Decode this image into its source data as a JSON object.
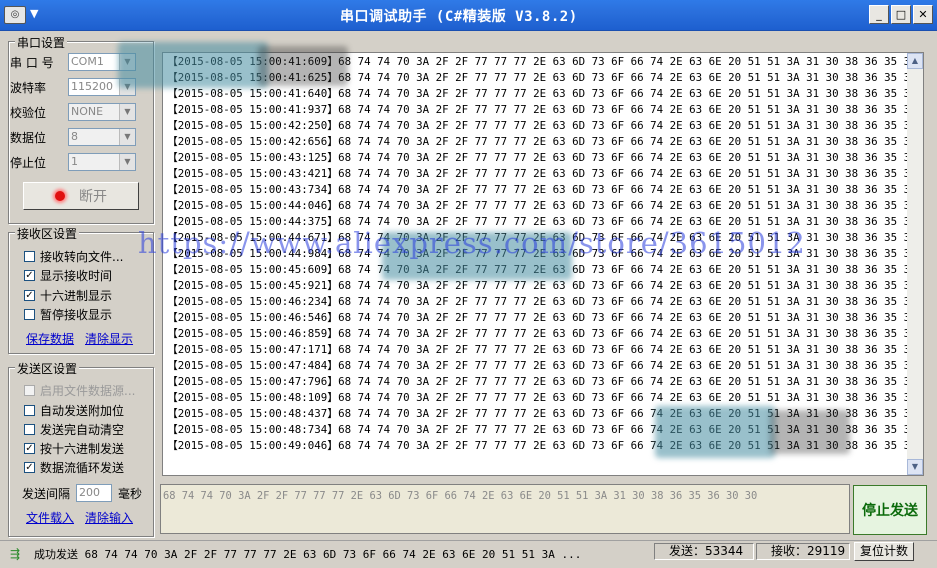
{
  "window": {
    "title": "串口调试助手 (C#精装版 V3.8.2)",
    "buttons": {
      "minimize": "_",
      "maximize": "□",
      "close": "✕"
    }
  },
  "serial_settings": {
    "legend": "串口设置",
    "port": {
      "label": "串 口 号",
      "value": "COM1"
    },
    "baud": {
      "label": "波特率",
      "value": "115200"
    },
    "parity": {
      "label": "校验位",
      "value": "NONE"
    },
    "databits": {
      "label": "数据位",
      "value": "8"
    },
    "stopbits": {
      "label": "停止位",
      "value": "1"
    },
    "open_button": "断开"
  },
  "receive_settings": {
    "legend": "接收区设置",
    "options": [
      {
        "label": "接收转向文件...",
        "checked": false
      },
      {
        "label": "显示接收时间",
        "checked": true
      },
      {
        "label": "十六进制显示",
        "checked": true
      },
      {
        "label": "暂停接收显示",
        "checked": false
      }
    ],
    "save_link": "保存数据",
    "clear_link": "清除显示"
  },
  "send_settings": {
    "legend": "发送区设置",
    "options": [
      {
        "label": "启用文件数据源...",
        "checked": false,
        "disabled": true
      },
      {
        "label": "自动发送附加位",
        "checked": false,
        "disabled": false
      },
      {
        "label": "发送完自动清空",
        "checked": false,
        "disabled": false
      },
      {
        "label": "按十六进制发送",
        "checked": true,
        "disabled": false
      },
      {
        "label": "数据流循环发送",
        "checked": true,
        "disabled": false
      }
    ],
    "interval_label": "发送间隔",
    "interval_value": "200",
    "interval_unit": "毫秒",
    "load_file_link": "文件载入",
    "clear_input_link": "清除输入"
  },
  "receive_area": {
    "payload": "68 74 74 70 3A 2F 2F 77 77 77 2E 63 6D 73 6F 66 74 2E 63 6E 20 51 51 3A 31 30 38 36 35 36 30 30",
    "lines": [
      "【2015-08-05 15:00:41:609】",
      "【2015-08-05 15:00:41:625】",
      "【2015-08-05 15:00:41:640】",
      "【2015-08-05 15:00:41:937】",
      "【2015-08-05 15:00:42:250】",
      "【2015-08-05 15:00:42:656】",
      "【2015-08-05 15:00:43:125】",
      "【2015-08-05 15:00:43:421】",
      "【2015-08-05 15:00:43:734】",
      "【2015-08-05 15:00:44:046】",
      "【2015-08-05 15:00:44:375】",
      "【2015-08-05 15:00:44:671】",
      "【2015-08-05 15:00:44:984】",
      "【2015-08-05 15:00:45:609】",
      "【2015-08-05 15:00:45:921】",
      "【2015-08-05 15:00:46:234】",
      "【2015-08-05 15:00:46:546】",
      "【2015-08-05 15:00:46:859】",
      "【2015-08-05 15:00:47:171】",
      "【2015-08-05 15:00:47:484】",
      "【2015-08-05 15:00:47:796】",
      "【2015-08-05 15:00:48:109】",
      "【2015-08-05 15:00:48:437】",
      "【2015-08-05 15:00:48:734】",
      "【2015-08-05 15:00:49:046】"
    ]
  },
  "send_area": {
    "text": "68 74 74 70 3A 2F 2F 77 77 77 2E 63 6D 73 6F 66 74 2E 63 6E 20 51 51 3A 31 30 38 36 35 36 30 30",
    "stop_button": "停止发送"
  },
  "status_bar": {
    "message": "成功发送 68 74 74 70 3A 2F 2F 77 77 77 2E 63 6D 73 6F 66 74 2E 63 6E 20 51 51 3A ...",
    "sent": "发送：53344",
    "received": "接收：29119",
    "reset_button": "复位计数"
  },
  "watermark": "https://www.aliexpress.com/store/3615012",
  "colors": {
    "titlebar": "#2a6fdc",
    "link": "#0000cc",
    "stop_button_text": "#0a6a0a",
    "led": "#e01010"
  }
}
